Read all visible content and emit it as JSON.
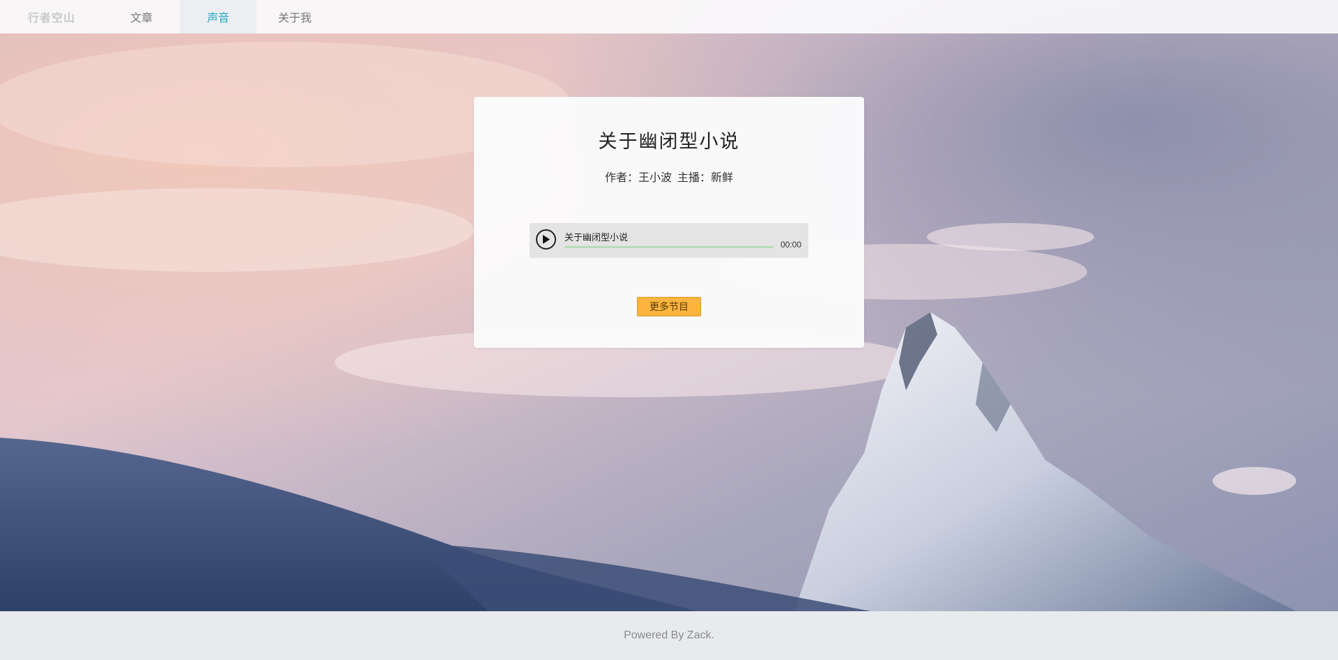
{
  "nav": {
    "brand": "行者空山",
    "items": [
      {
        "label": "文章",
        "active": false
      },
      {
        "label": "声音",
        "active": true
      },
      {
        "label": "关于我",
        "active": false
      }
    ],
    "active_color": "#25a8c6"
  },
  "card": {
    "title": "关于幽闭型小说",
    "author": "作者：王小波",
    "host": "主播：新鲜",
    "player": {
      "track_title": "关于幽闭型小说",
      "time": "00:00",
      "progress": 0,
      "play_icon": "play-icon"
    },
    "more_button": "更多节目",
    "more_button_color": "#fbb43f"
  },
  "footer": {
    "text": "Powered By Zack."
  }
}
